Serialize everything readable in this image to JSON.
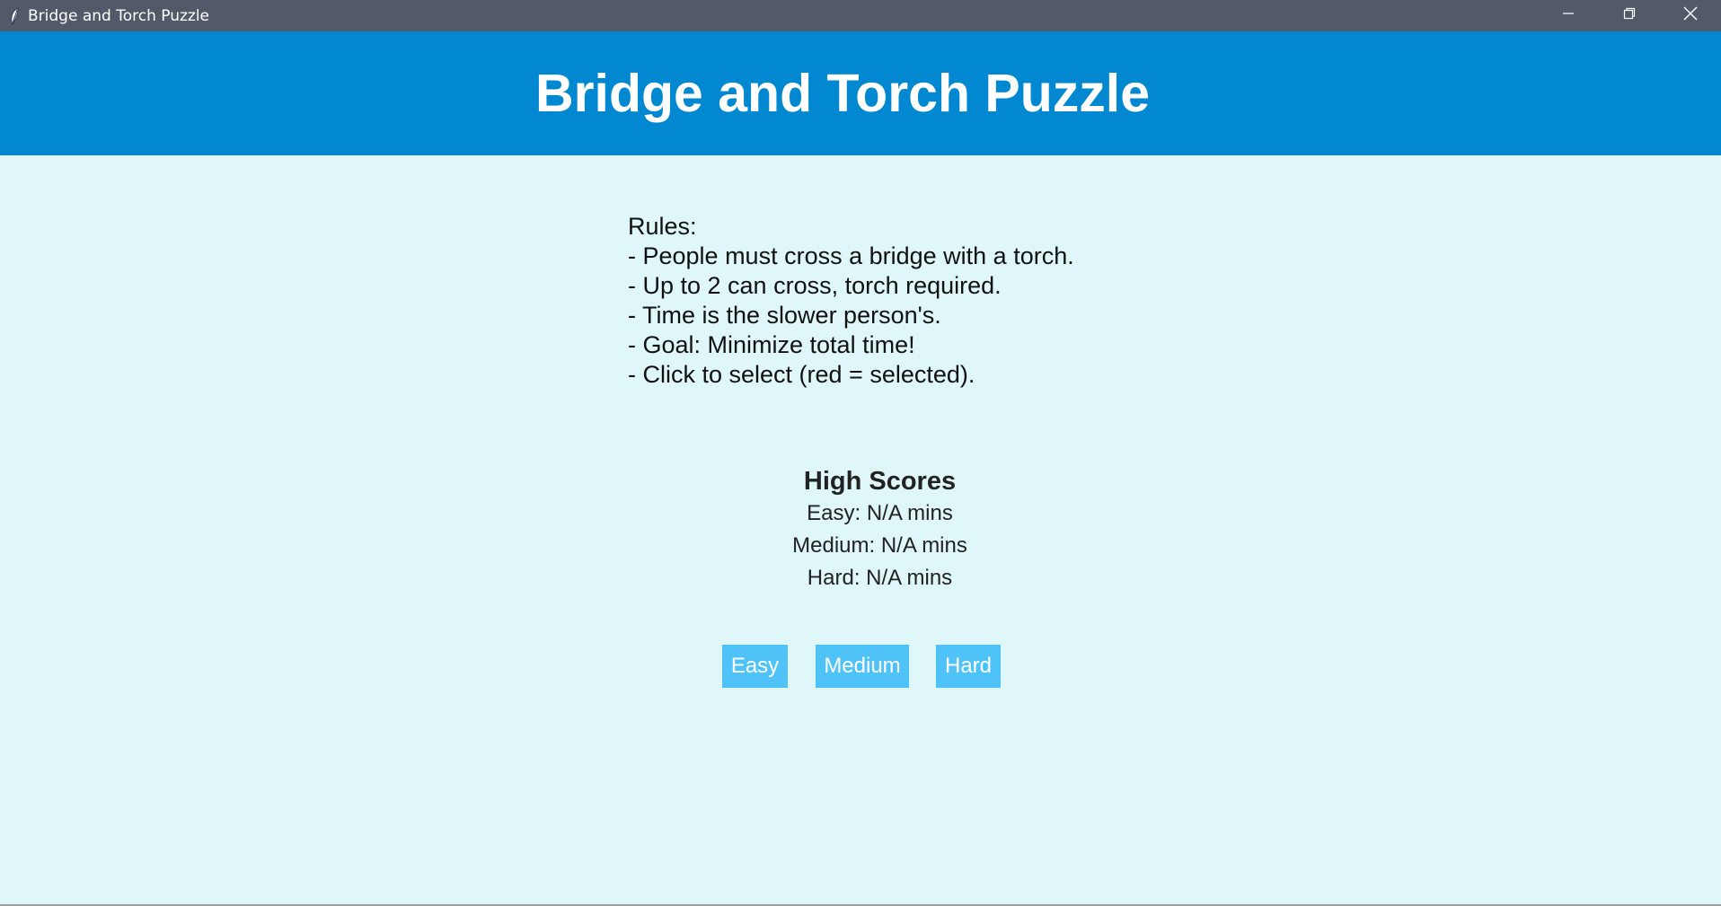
{
  "window": {
    "title": "Bridge and Torch Puzzle",
    "icon": "feather-icon",
    "controls": [
      "minimize-icon",
      "restore-icon",
      "close-icon"
    ]
  },
  "header": {
    "title": "Bridge and Torch Puzzle"
  },
  "rules": {
    "heading": "Rules:",
    "lines": [
      "- People must cross a bridge with a torch.",
      "- Up to 2 can cross, torch required.",
      "- Time is the slower person's.",
      "- Goal: Minimize total time!",
      "- Click to select (red = selected)."
    ]
  },
  "high_scores": {
    "heading": "High Scores",
    "entries": [
      "Easy: N/A mins",
      "Medium: N/A mins",
      "Hard: N/A mins"
    ]
  },
  "difficulty_buttons": {
    "easy": "Easy",
    "medium": "Medium",
    "hard": "Hard"
  },
  "colors": {
    "titlebar": "#525A69",
    "header": "#0288D1",
    "background": "#E0F7FA",
    "button": "#4FC3F7"
  }
}
